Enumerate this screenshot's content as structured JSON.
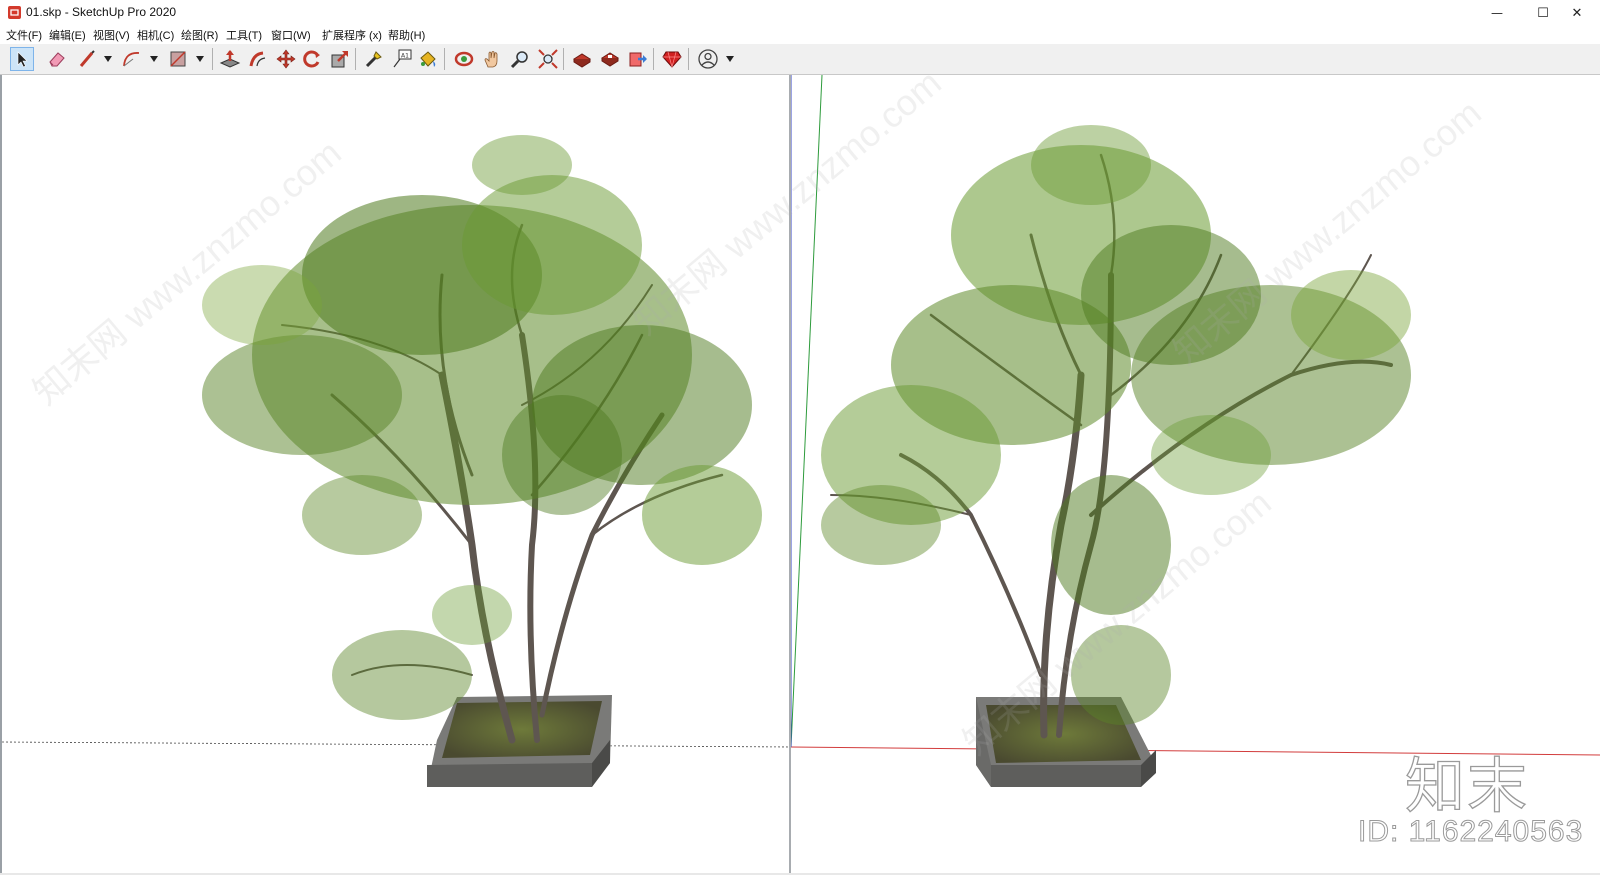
{
  "window": {
    "title": "01.skp - SketchUp Pro 2020",
    "minimize_glyph": "—",
    "maximize_glyph": "☐",
    "close_glyph": "✕"
  },
  "menu": [
    {
      "label": "文件(F)"
    },
    {
      "label": "编辑(E)"
    },
    {
      "label": "视图(V)"
    },
    {
      "label": "相机(C)"
    },
    {
      "label": "绘图(R)"
    },
    {
      "label": "工具(T)"
    },
    {
      "label": "窗口(W)"
    },
    {
      "label": "扩展程序 (x)"
    },
    {
      "label": "帮助(H)"
    }
  ],
  "toolbar": {
    "tools": [
      {
        "name": "select-tool-icon",
        "active": true
      },
      {
        "name": "eraser-tool-icon"
      },
      {
        "name": "line-tool-icon"
      },
      {
        "name": "arc-tool-icon"
      },
      {
        "name": "rectangle-tool-icon"
      },
      {
        "name": "push-pull-tool-icon"
      },
      {
        "name": "offset-tool-icon"
      },
      {
        "name": "move-tool-icon"
      },
      {
        "name": "rotate-tool-icon"
      },
      {
        "name": "scale-tool-icon"
      },
      {
        "name": "tape-measure-tool-icon"
      },
      {
        "name": "text-tool-icon"
      },
      {
        "name": "paint-bucket-tool-icon"
      },
      {
        "name": "orbit-tool-icon"
      },
      {
        "name": "pan-tool-icon"
      },
      {
        "name": "zoom-tool-icon"
      },
      {
        "name": "zoom-extents-tool-icon"
      },
      {
        "name": "3d-warehouse-icon"
      },
      {
        "name": "extension-warehouse-icon"
      },
      {
        "name": "send-to-layout-icon"
      },
      {
        "name": "ruby-console-icon"
      },
      {
        "name": "account-icon"
      }
    ]
  },
  "colors": {
    "axis_red": "#d23c3c",
    "axis_green": "#2e9b3c",
    "axis_blue": "#3a48c8",
    "leaf_dark": "#4e7a1e",
    "leaf_light": "#7aa43a",
    "trunk": "#5e5650",
    "planter": "#6e6e6e",
    "soil": "#5a5a3a"
  },
  "watermark": {
    "brand": "知末",
    "id_text": "ID: 1162240563",
    "diagonal": "知末网 www.znzmo.com"
  }
}
